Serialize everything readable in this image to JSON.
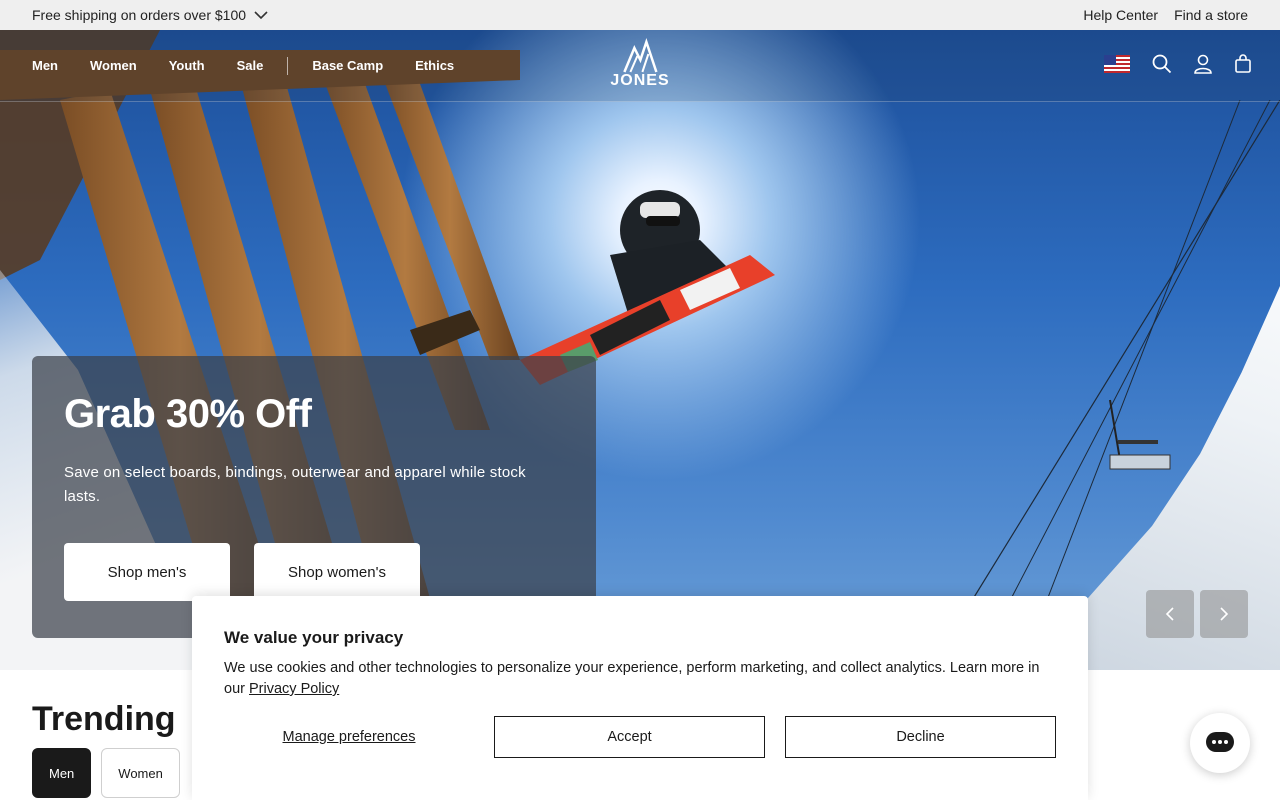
{
  "announcement": {
    "shipping_text": "Free shipping on orders over $100",
    "help_center": "Help Center",
    "find_store": "Find a store"
  },
  "nav": {
    "items": [
      "Men",
      "Women",
      "Youth",
      "Sale",
      "Base Camp",
      "Ethics"
    ]
  },
  "brand": {
    "logo_text": "JONES"
  },
  "hero": {
    "headline": "Grab 30% Off",
    "subtext": "Save on select boards, bindings, outerwear and apparel while stock lasts.",
    "shop_mens": "Shop men's",
    "shop_womens": "Shop women's"
  },
  "trending": {
    "title": "Trending",
    "tabs": [
      "Men",
      "Women"
    ]
  },
  "cookie": {
    "title": "We value your privacy",
    "body": "We use cookies and other technologies to personalize your experience, perform marketing, and collect analytics. Learn more in our ",
    "policy_link": "Privacy Policy",
    "manage": "Manage preferences",
    "accept": "Accept",
    "decline": "Decline"
  },
  "icons": [
    "chevron-down-icon",
    "us-flag-icon",
    "search-icon",
    "account-icon",
    "cart-icon",
    "arrow-left-icon",
    "arrow-right-icon",
    "chat-icon"
  ]
}
